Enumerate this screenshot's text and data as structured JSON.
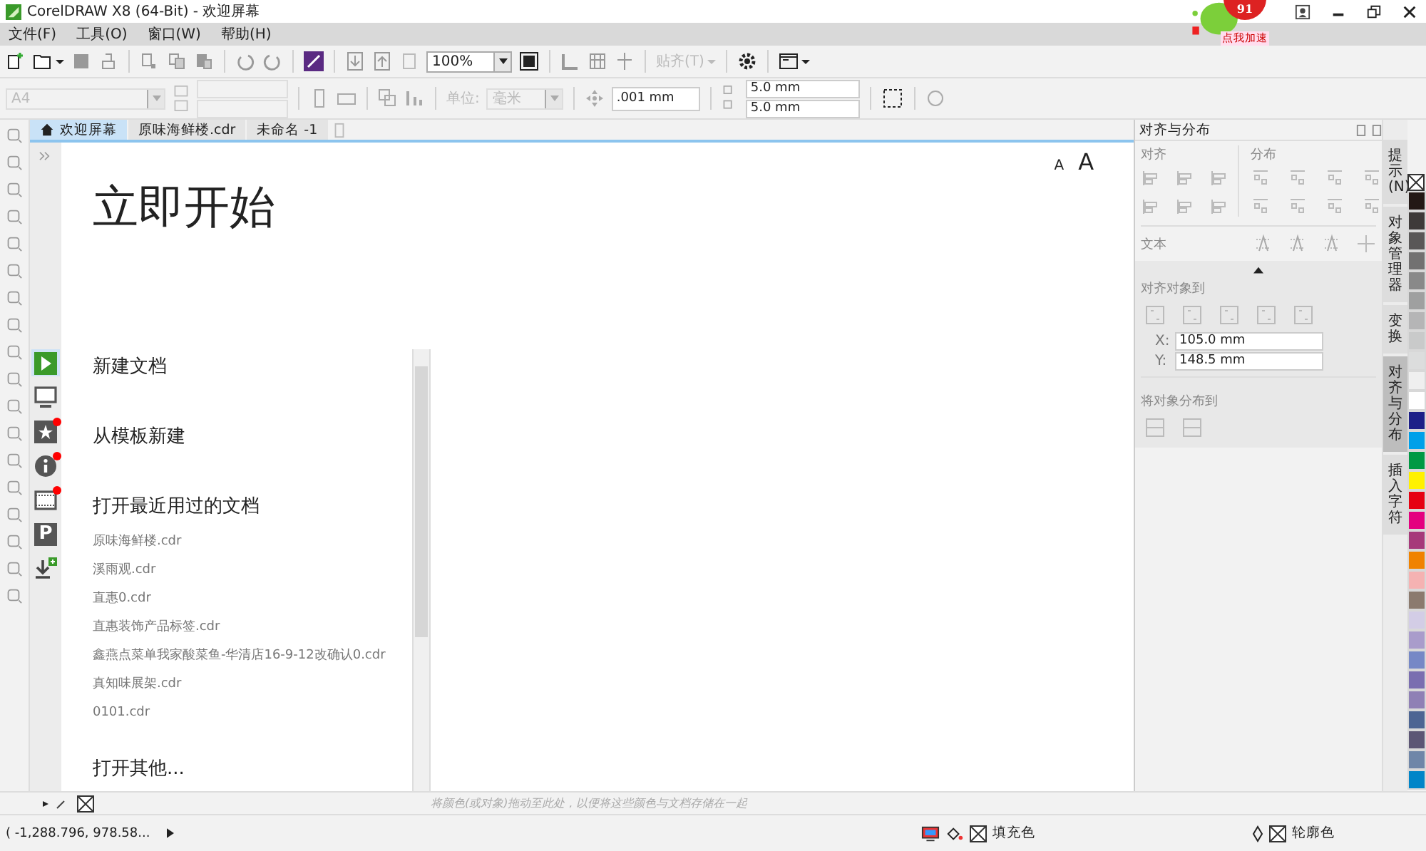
{
  "window": {
    "title": "CorelDRAW X8 (64-Bit) - 欢迎屏幕"
  },
  "overlay_widget": {
    "count": "91",
    "label": "点我加速"
  },
  "menu": [
    {
      "label": "文件(F)"
    },
    {
      "label": "工具(O)"
    },
    {
      "label": "窗口(W)"
    },
    {
      "label": "帮助(H)"
    }
  ],
  "toolbar": {
    "zoom": "100%",
    "snap": "贴齐(T)"
  },
  "property_bar": {
    "paper": "A4",
    "units_label": "单位:",
    "units": "毫米",
    "nudge": ".001 mm",
    "dup_x": "5.0 mm",
    "dup_y": "5.0 mm"
  },
  "tabs": [
    {
      "label": "欢迎屏幕",
      "selected": true
    },
    {
      "label": "原味海鲜楼.cdr",
      "selected": false
    },
    {
      "label": "未命名 -1",
      "selected": false
    }
  ],
  "welcome": {
    "font_small": "A",
    "font_large": "A",
    "heading": "立即开始",
    "side_icons": [
      {
        "kind": "play",
        "selected": true,
        "notification": false
      },
      {
        "kind": "monitor",
        "selected": false,
        "notification": false
      },
      {
        "kind": "star",
        "selected": false,
        "notification": true
      },
      {
        "kind": "info",
        "selected": false,
        "notification": true
      },
      {
        "kind": "film",
        "selected": false,
        "notification": true
      },
      {
        "kind": "letter",
        "glyph": "P",
        "selected": false,
        "notification": false
      },
      {
        "kind": "download",
        "selected": false,
        "notification": false
      }
    ],
    "new_document": "新建文档",
    "from_template": "从模板新建",
    "recent_heading": "打开最近用过的文档",
    "recent_files": [
      "原味海鲜楼.cdr",
      "溪雨观.cdr",
      "直惠0.cdr",
      "直惠装饰产品标签.cdr",
      "鑫燕点菜单我家酸菜鱼-华清店16-9-12改确认0.cdr",
      "真知味展架.cdr",
      "0101.cdr"
    ],
    "open_other": "打开其他..."
  },
  "docker": {
    "title": "对齐与分布",
    "align_label": "对齐",
    "distribute_label": "分布",
    "text_label": "文本",
    "align_to_label": "对齐对象到",
    "x_label": "X:",
    "x": "105.0 mm",
    "y_label": "Y:",
    "y": "148.5 mm",
    "distribute_to_label": "将对象分布到"
  },
  "docker_tabs": [
    {
      "label": "提示(N)",
      "selected": false
    },
    {
      "label": "对象管理器",
      "selected": false
    },
    {
      "label": "变换",
      "selected": false
    },
    {
      "label": "对齐与分布",
      "selected": true
    },
    {
      "label": "插入字符",
      "selected": false
    }
  ],
  "palette": [
    {
      "color": "#231815"
    },
    {
      "color": "#3e3a39"
    },
    {
      "color": "#595757"
    },
    {
      "color": "#727171"
    },
    {
      "color": "#898989"
    },
    {
      "color": "#9fa0a0"
    },
    {
      "color": "#b5b5b6"
    },
    {
      "color": "#c9caca"
    },
    {
      "color": "#dcdddd"
    },
    {
      "color": "#efefef"
    },
    {
      "color": "#ffffff"
    },
    {
      "color": "#1d2088"
    },
    {
      "color": "#00a0e9"
    },
    {
      "color": "#009944"
    },
    {
      "color": "#fff100"
    },
    {
      "color": "#e60012"
    },
    {
      "color": "#e4007f"
    },
    {
      "color": "#a6397a"
    },
    {
      "color": "#f08200"
    },
    {
      "color": "#f5b2b2"
    },
    {
      "color": "#8b7a6e"
    },
    {
      "color": "#d3cde6"
    },
    {
      "color": "#a99ccb"
    },
    {
      "color": "#7688c6"
    },
    {
      "color": "#7a6eb0"
    },
    {
      "color": "#8f80b5"
    },
    {
      "color": "#4d6593"
    },
    {
      "color": "#5c5675"
    },
    {
      "color": "#6f86a8"
    },
    {
      "color": "#0085c8"
    }
  ],
  "color_tray": {
    "hint": "将颜色(或对象)拖动至此处，以便将这些颜色与文档存储在一起"
  },
  "status_bar": {
    "coords": "( -1,288.796, 978.58...",
    "fill_label": "填充色",
    "outline_label": "轮廓色"
  }
}
